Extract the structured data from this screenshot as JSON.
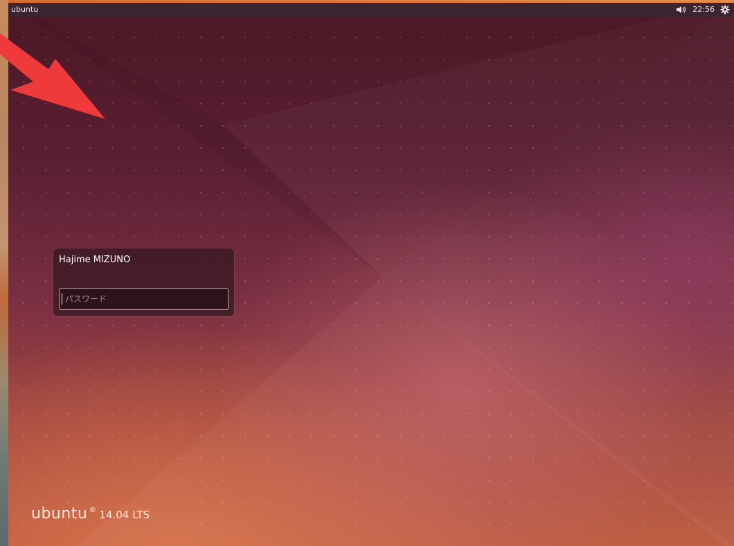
{
  "top_panel": {
    "title": "ubuntu",
    "clock": "22:56",
    "volume_icon": "volume-icon",
    "power_icon": "gear-power-icon"
  },
  "login": {
    "user_name": "Hajime MIZUNO",
    "password_placeholder": "パスワード",
    "password_value": ""
  },
  "branding": {
    "name": "ubuntu",
    "mark": "®",
    "version": "14.04 LTS"
  },
  "colors": {
    "panel_bg": "#3a2530",
    "accent_orange": "#e2783a",
    "arrow": "#f0393a"
  }
}
